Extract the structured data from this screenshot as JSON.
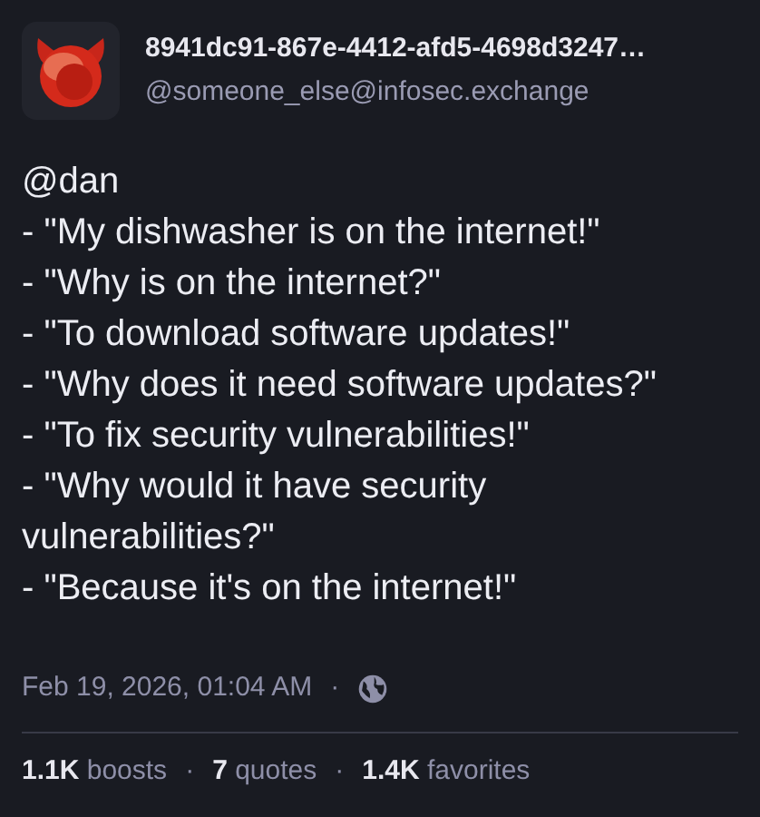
{
  "author": {
    "display_name": "8941dc91-867e-4412-afd5-4698d3247…",
    "handle": "@someone_else@infosec.exchange"
  },
  "body": [
    "@dan",
    "- \"My dishwasher is on the internet!\"",
    "- \"Why is on the internet?\"",
    "- \"To download software updates!\"",
    "- \"Why does it need software updates?\"",
    "- \"To fix security vulnerabilities!\"",
    "- \"Why would it have security vulnerabilities?\"",
    "- \"Because it's on the internet!\""
  ],
  "timestamp": "Feb 19, 2026, 01:04 AM",
  "separator": "·",
  "public": true,
  "stats": [
    {
      "count": "1.1K",
      "label": "boosts"
    },
    {
      "count": "7",
      "label": "quotes"
    },
    {
      "count": "1.4K",
      "label": "favorites"
    }
  ]
}
